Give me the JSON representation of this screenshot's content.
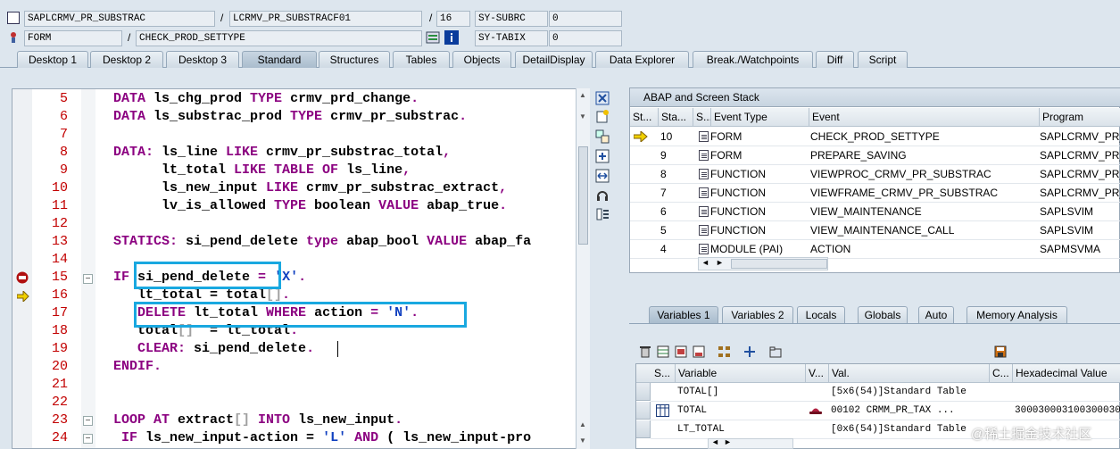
{
  "header": {
    "program": "SAPLCRMV_PR_SUBSTRAC",
    "include": "LCRMV_PR_SUBSTRACF01",
    "line": "16",
    "subrc_label": "SY-SUBRC",
    "subrc_value": "0",
    "event_type": "FORM",
    "event": "CHECK_PROD_SETTYPE",
    "tabix_label": "SY-TABIX",
    "tabix_value": "0"
  },
  "tabs": [
    "Desktop 1",
    "Desktop 2",
    "Desktop 3",
    "Standard",
    "Structures",
    "Tables",
    "Objects",
    "DetailDisplay",
    "Data Explorer",
    "Break./Watchpoints",
    "Diff",
    "Script"
  ],
  "active_tab": "Standard",
  "code_lines": [
    {
      "n": "5",
      "t": [
        [
          "kw",
          "DATA "
        ],
        [
          "",
          "ls_chg_prod "
        ],
        [
          "kw",
          "TYPE "
        ],
        [
          "",
          "crmv_prd_change"
        ],
        [
          "kw",
          "."
        ]
      ]
    },
    {
      "n": "6",
      "t": [
        [
          "kw",
          "DATA "
        ],
        [
          "",
          "ls_substrac_prod "
        ],
        [
          "kw",
          "TYPE "
        ],
        [
          "",
          "crmv_pr_substrac"
        ],
        [
          "kw",
          "."
        ]
      ]
    },
    {
      "n": "7",
      "t": []
    },
    {
      "n": "8",
      "t": [
        [
          "kw",
          "DATA: "
        ],
        [
          "",
          "ls_line "
        ],
        [
          "kw",
          "LIKE "
        ],
        [
          "",
          "crmv_pr_substrac_total"
        ],
        [
          "kw",
          ","
        ]
      ]
    },
    {
      "n": "9",
      "t": [
        [
          "",
          "      lt_total "
        ],
        [
          "kw",
          "LIKE TABLE OF "
        ],
        [
          "",
          "ls_line"
        ],
        [
          "kw",
          ","
        ]
      ]
    },
    {
      "n": "10",
      "t": [
        [
          "",
          "      ls_new_input "
        ],
        [
          "kw",
          "LIKE "
        ],
        [
          "",
          "crmv_pr_substrac_extract"
        ],
        [
          "kw",
          ","
        ]
      ]
    },
    {
      "n": "11",
      "t": [
        [
          "",
          "      lv_is_allowed "
        ],
        [
          "kw",
          "TYPE "
        ],
        [
          "",
          "boolean "
        ],
        [
          "kw",
          "VALUE "
        ],
        [
          "",
          "abap_true"
        ],
        [
          "kw",
          "."
        ]
      ]
    },
    {
      "n": "12",
      "t": []
    },
    {
      "n": "13",
      "t": [
        [
          "kw",
          "STATICS: "
        ],
        [
          "",
          "si_pend_delete "
        ],
        [
          "kw",
          "type "
        ],
        [
          "",
          "abap_bool "
        ],
        [
          "kw",
          "VALUE "
        ],
        [
          "",
          "abap_fa"
        ]
      ]
    },
    {
      "n": "14",
      "t": []
    },
    {
      "n": "15",
      "t": [
        [
          "kw",
          "IF "
        ],
        [
          "",
          "si_pend_delete "
        ],
        [
          "kw",
          "= "
        ],
        [
          "st",
          "'X'"
        ],
        [
          "kw",
          "."
        ]
      ]
    },
    {
      "n": "16",
      "t": [
        [
          "",
          "   lt_total = total"
        ],
        [
          "cm",
          "[]"
        ],
        [
          "kw",
          "."
        ]
      ]
    },
    {
      "n": "17",
      "t": [
        [
          "",
          "   "
        ],
        [
          "kw",
          "DELETE "
        ],
        [
          "",
          "lt_total "
        ],
        [
          "kw",
          "WHERE "
        ],
        [
          "",
          "action "
        ],
        [
          "kw",
          "= "
        ],
        [
          "st",
          "'N'"
        ],
        [
          "kw",
          "."
        ]
      ]
    },
    {
      "n": "18",
      "t": [
        [
          "",
          "   total"
        ],
        [
          "cm",
          "[]"
        ],
        [
          "",
          "  = lt_total"
        ],
        [
          "kw",
          "."
        ]
      ]
    },
    {
      "n": "19",
      "t": [
        [
          "",
          "   "
        ],
        [
          "kw",
          "CLEAR: "
        ],
        [
          "",
          "si_pend_delete"
        ],
        [
          "kw",
          "."
        ]
      ]
    },
    {
      "n": "20",
      "t": [
        [
          "kw",
          "ENDIF."
        ]
      ]
    },
    {
      "n": "21",
      "t": []
    },
    {
      "n": "22",
      "t": []
    },
    {
      "n": "23",
      "t": [
        [
          "kw",
          "LOOP AT "
        ],
        [
          "",
          "extract"
        ],
        [
          "cm",
          "[]"
        ],
        [
          "kw",
          " INTO "
        ],
        [
          "",
          "ls_new_input"
        ],
        [
          "kw",
          "."
        ]
      ]
    },
    {
      "n": "24",
      "t": [
        [
          "",
          ""
        ],
        [
          "kw",
          " IF "
        ],
        [
          "",
          "ls_new_input-action = "
        ],
        [
          "st",
          "'L'"
        ],
        [
          "kw",
          " AND "
        ],
        [
          "",
          "( ls_new_input-pro"
        ]
      ]
    }
  ],
  "stack": {
    "title": "ABAP and Screen Stack",
    "columns": [
      "St...",
      "Sta...",
      "S...",
      "Event Type",
      "Event",
      "Program"
    ],
    "rows": [
      {
        "level": "10",
        "type": "FORM",
        "event": "CHECK_PROD_SETTYPE",
        "program": "SAPLCRMV_PR_S",
        "current": true
      },
      {
        "level": "9",
        "type": "FORM",
        "event": "PREPARE_SAVING",
        "program": "SAPLCRMV_PR_S",
        "current": false
      },
      {
        "level": "8",
        "type": "FUNCTION",
        "event": "VIEWPROC_CRMV_PR_SUBSTRAC",
        "program": "SAPLCRMV_PR_S",
        "current": false
      },
      {
        "level": "7",
        "type": "FUNCTION",
        "event": "VIEWFRAME_CRMV_PR_SUBSTRAC",
        "program": "SAPLCRMV_PR_S",
        "current": false
      },
      {
        "level": "6",
        "type": "FUNCTION",
        "event": "VIEW_MAINTENANCE",
        "program": "SAPLSVIM",
        "current": false
      },
      {
        "level": "5",
        "type": "FUNCTION",
        "event": "VIEW_MAINTENANCE_CALL",
        "program": "SAPLSVIM",
        "current": false
      },
      {
        "level": "4",
        "type": "MODULE (PAI)",
        "event": "ACTION",
        "program": "SAPMSVMA",
        "current": false
      }
    ]
  },
  "var_tabs": [
    "Variables 1",
    "Variables 2",
    "Locals",
    "Globals",
    "Auto",
    "Memory Analysis"
  ],
  "vars": {
    "columns": [
      "S...",
      "Variable",
      "V...",
      "Val.",
      "C...",
      "Hexadecimal Value"
    ],
    "rows": [
      {
        "name": "TOTAL[]",
        "value": "[5x6(54)]Standard Table",
        "hex": ""
      },
      {
        "name": "TOTAL",
        "value": "00102    CRMM_PR_TAX    ...",
        "hex": "3000300031003000300"
      },
      {
        "name": "LT_TOTAL",
        "value": "[0x6(54)]Standard Table",
        "hex": ""
      }
    ]
  },
  "watermark": "@稀土掘金技术社区"
}
